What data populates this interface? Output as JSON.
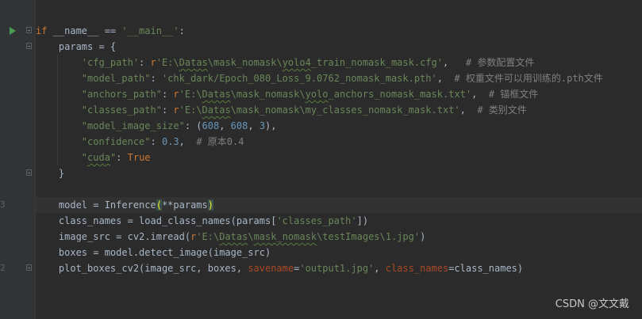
{
  "gutter": {
    "line_numbers": [
      "",
      "",
      "",
      "",
      "",
      "",
      "",
      "",
      "",
      "",
      "",
      "",
      "3",
      "",
      "",
      "",
      "2"
    ]
  },
  "code": {
    "l1_kw": "if",
    "l1_a": " __name__ == ",
    "l1_str": "'__main__'",
    "l1_b": ":",
    "l2_a": "    params = {",
    "l3_indent": "        ",
    "l3_key": "'cfg_path'",
    "l3_colon": ": ",
    "l3_r": "r",
    "l3_val_a": "'E:\\",
    "l3_val_sq1": "Datas",
    "l3_val_b": "\\mask_nomask\\",
    "l3_val_sq2": "yolo4",
    "l3_val_c": "_train_nomask_mask.cfg'",
    "l3_comma": ",   ",
    "l3_cmt": "# 参数配置文件",
    "l4_indent": "        ",
    "l4_key": "\"model_path\"",
    "l4_colon": ": ",
    "l4_val": "'chk_dark/Epoch_080_Loss_9.0762_nomask_mask.pth'",
    "l4_comma": ",  ",
    "l4_cmt": "# 权重文件可以用训练的.pth文件",
    "l5_indent": "        ",
    "l5_key": "\"anchors_path\"",
    "l5_colon": ": ",
    "l5_r": "r",
    "l5_val_a": "'E:\\",
    "l5_val_sq1": "Datas",
    "l5_val_b": "\\mask_nomask\\",
    "l5_val_sq2": "yolo",
    "l5_val_c": "_anchors_nomask_mask.txt'",
    "l5_comma": ",  ",
    "l5_cmt": "# 锚框文件",
    "l6_indent": "        ",
    "l6_key": "\"classes_path\"",
    "l6_colon": ": ",
    "l6_r": "r",
    "l6_val_a": "'E:\\",
    "l6_val_sq1": "Datas",
    "l6_val_b": "\\mask_nomask\\my_classes_nomask_mask.txt'",
    "l6_comma": ",  ",
    "l6_cmt": "# 类别文件",
    "l7_indent": "        ",
    "l7_key": "\"model_image_size\"",
    "l7_a": ": (",
    "l7_n1": "608",
    "l7_c1": ", ",
    "l7_n2": "608",
    "l7_c2": ", ",
    "l7_n3": "3",
    "l7_b": "),",
    "l8_indent": "        ",
    "l8_key": "\"confidence\"",
    "l8_colon": ": ",
    "l8_num": "0.3",
    "l8_comma": ",  ",
    "l8_cmt": "# 原本0.4",
    "l9_indent": "        ",
    "l9_key_q1": "\"",
    "l9_key_sq": "cuda",
    "l9_key_q2": "\"",
    "l9_colon": ": ",
    "l9_kw": "True",
    "l10": "    }",
    "l11": "",
    "l12_a": "    model = Inference",
    "l12_open": "(",
    "l12_mid": "**params",
    "l12_close": ")",
    "l13_a": "    class_names = load_class_names(params[",
    "l13_str": "'classes_path'",
    "l13_b": "])",
    "l14_a": "    image_src = cv2.imread(",
    "l14_r": "r",
    "l14_val_a": "'E:\\",
    "l14_val_sq1": "Datas",
    "l14_val_b": "\\",
    "l14_val_sq2": "mask_nomask",
    "l14_val_c": "\\testImages\\1.jpg'",
    "l14_b": ")",
    "l15": "    boxes = model.detect_image(image_src)",
    "l16_a": "    plot_boxes_cv2(image_src, boxes, ",
    "l16_p1": "savename",
    "l16_eq1": "=",
    "l16_s1": "'output1.jpg'",
    "l16_c": ", ",
    "l16_p2": "class_names",
    "l16_eq2": "=class_names)"
  },
  "watermark": "CSDN @文文戴",
  "colors": {
    "background": "#2b2b2b",
    "keyword": "#cc7832",
    "string": "#6a8759",
    "number": "#6897bb",
    "comment": "#808080",
    "named_param": "#aa4926",
    "run_icon": "#499c54"
  },
  "icons": [
    "run-icon",
    "fold-icon"
  ]
}
